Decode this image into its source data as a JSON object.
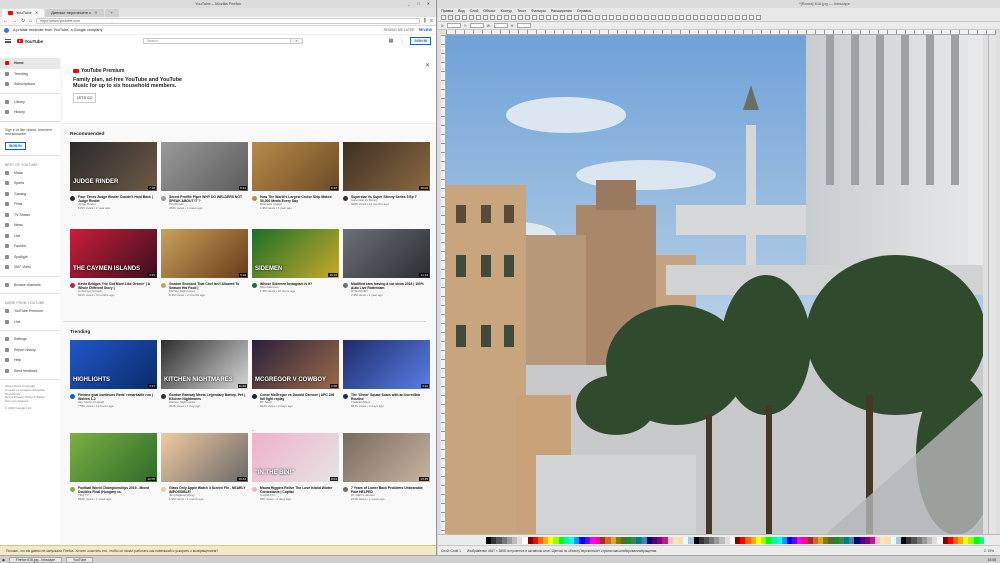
{
  "firefox": {
    "title": "YouTube – Mozilla Firefox",
    "tabs": [
      {
        "label": "YouTube",
        "active": true
      },
      {
        "label": "Данные перенесите с"
      },
      {
        "label": "+"
      }
    ],
    "url": "https://www.youtube.com",
    "banner": {
      "text": "A private reminder from YouTube, a Google company",
      "remind": "REMIND ME LATER",
      "review": "REVIEW"
    },
    "status": "Похоже, что вы давно не запускали Firefox. Хотите очистить его, чтобы он начал работать как новенький и ускорить с возвращением?"
  },
  "youtube": {
    "logo": "YouTube",
    "search_placeholder": "Search",
    "signin": "SIGN IN",
    "sidebar": {
      "items": [
        "Home",
        "Trending",
        "Subscriptions"
      ],
      "items2": [
        "Library",
        "History"
      ],
      "note": "Sign in to like videos, comment and subscribe.",
      "signin": "SIGN IN",
      "best_header": "BEST OF YOUTUBE",
      "best": [
        "Music",
        "Sports",
        "Gaming",
        "Films",
        "TV Shows",
        "News",
        "Live",
        "Fashion",
        "Spotlight",
        "360° Video"
      ],
      "browse": "Browse channels",
      "more_header": "MORE FROM YOUTUBE",
      "more": [
        "YouTube Premium",
        "Live"
      ],
      "settings": [
        "Settings",
        "Report history",
        "Help",
        "Send feedback"
      ],
      "footer1": "About   Press   Copyright",
      "footer2": "Contact us   Creators   Advertise",
      "footer3": "Developers",
      "footer4": "Terms   Privacy   Policy & Safety",
      "footer5": "Test new features",
      "copyright": "© 2020 Google LLC"
    },
    "premium": {
      "logo": "YouTube Premium",
      "text": "Family plan, ad-free YouTube and YouTube Music for up to six household members.",
      "button": "LET'S GO"
    },
    "recommended_title": "Recommended",
    "trending_title": "Trending",
    "recommended": [
      {
        "title": "Four Times Judge Rinder Couldn't Hold Back | Judge Rinder",
        "channel": "Judge Rinder",
        "views": "135K views • 1 year ago",
        "dur": "7:18",
        "thumb": "JUDGE RINDER"
      },
      {
        "title": "Secret Prolific Piper WHY DO WELDERS NOT SPEAK ABOUT IT ?",
        "channel": "Pinsforsale",
        "views": "286K views • 1 week ago",
        "dur": "8:34",
        "thumb": ""
      },
      {
        "title": "How The World's Largest Cruise Ship Makes 30,000 Meals Every Day",
        "channel": "Business Insider",
        "views": "1.9M views • 1 year ago",
        "dur": "6:48",
        "thumb": ""
      },
      {
        "title": "Superstar Vs Super Skinny Series 5 Ep 7",
        "channel": "Superstar vs Skinny",
        "views": "405K views • 11 months ago",
        "dur": "48:06",
        "thumb": ""
      },
      {
        "title": "Kevin Bridges 'I've Got More Like Greece' | A Whole Different Story |",
        "channel": "Universal Comedy",
        "views": "924K views • 3 months ago",
        "dur": "4:35",
        "thumb": "THE CAYMEN ISLANDS"
      },
      {
        "title": "Gordon Shocked That Chef Isn't Allowed To Season His Food |",
        "channel": "Kitchen Nightmares",
        "views": "8.3M views • 3 months ago",
        "dur": "9:26",
        "thumb": ""
      },
      {
        "title": "Whose Sidemen Instagram is it?",
        "channel": "MoreSidemen",
        "views": "1.3M views • 10 hours ago",
        "dur": "19:16",
        "thumb": "SIDEMEN"
      },
      {
        "title": "Modified cars leaving a car show 2018 | 100% Auto Live Rotterdam",
        "channel": "NTHsStORY",
        "views": "2.3M views • 1 year ago",
        "dur": "14:34",
        "thumb": ""
      }
    ],
    "trending": [
      {
        "title": "Firmino goal continues Reds' remarkable run | Wolves 1-2",
        "channel": "Sky Sports Football",
        "views": "778K views • 13 hours ago",
        "dur": "4:37",
        "thumb": "HIGHLIGHTS"
      },
      {
        "title": "Gordon Ramsay Meets Legendary Bartop, Pet | Kitchen Nightmares",
        "channel": "Kitchen Nightmares",
        "views": "304K views • 1 day ago",
        "dur": "11:30",
        "thumb": "KITCHEN NIGHTMARES"
      },
      {
        "title": "Conor McGregor vs Donald Cerrone | UFC 246 full fight replay",
        "channel": "BT Sport",
        "views": "824K views • 2 days ago",
        "dur": "1:08",
        "thumb": "MCGREGOR V COWBOY"
      },
      {
        "title": "The 'Chear' Squad Soars with an Incredible Routine",
        "channel": "TheEllenShow",
        "views": "827K views • 2 days ago",
        "dur": "4:22",
        "thumb": ""
      },
      {
        "title": "Football World Championships 2019 - Mixed Doubles Final (Hungary vs.",
        "channel": "TEQ TV",
        "views": "820K views • 1 week ago",
        "dur": "12:05",
        "thumb": ""
      },
      {
        "title": "Glass Only Apple Watch 4 Screen Fix - NEARLY IMPOSSIBLE!",
        "channel": "JerryRigEverything",
        "views": "1.9M views • 1 month ago",
        "dur": "16:42",
        "thumb": ""
      },
      {
        "title": "Maura Higgins Relive The Love Island Winter Contestants | Capital",
        "channel": "Capital FM",
        "views": "66K views • 2 days ago",
        "dur": "8:04",
        "thumb": "\"IN THE BIN!\""
      },
      {
        "title": "7 Years of Lower Back Problems Unbearable Pain HELPED",
        "channel": "Dr. Rahim Jansen",
        "views": "213K views • 1 week ago",
        "dur": "13:45",
        "thumb": ""
      }
    ],
    "chevron": "⌄"
  },
  "gimp": {
    "title": "*[Roma] 616.jpg — Inkscape",
    "menu": [
      "Правка",
      "Вид",
      "Слой",
      "Объект",
      "Контур",
      "Текст",
      "Фильтры",
      "Расширения",
      "Справка"
    ],
    "opts": [
      "X:",
      "Y:",
      "W:",
      "H:"
    ],
    "status_left": "Слой: Слой 1",
    "status": "Изображение 4567 × 3658: встроенное в активном слое. Щелчок по объекту переключает стрелки масштабирования/вращения.",
    "zoom": "Z: 19%"
  },
  "taskbar": {
    "items": [
      "Firefox 616.jpg - Inkscape",
      "YouTube"
    ],
    "clock": "10:05"
  }
}
